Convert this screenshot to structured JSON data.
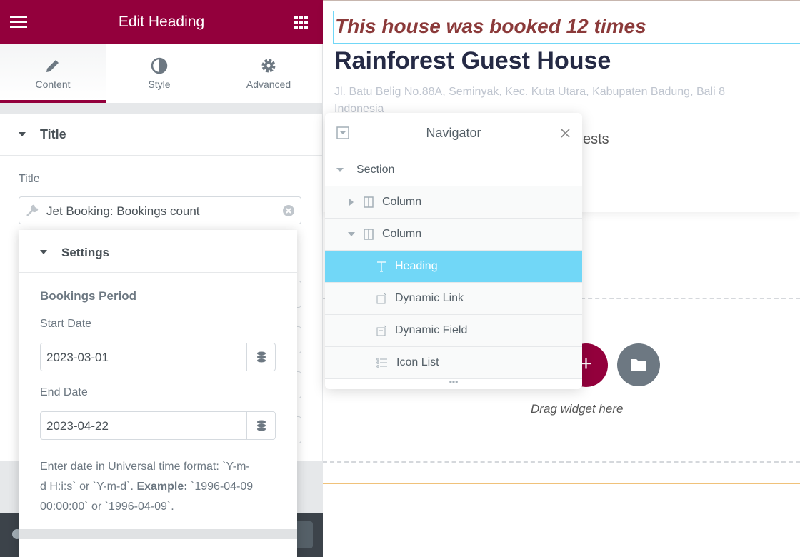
{
  "panel": {
    "title": "Edit Heading",
    "tabs": [
      {
        "label": "Content",
        "icon": "pencil-icon"
      },
      {
        "label": "Style",
        "icon": "contrast-icon"
      },
      {
        "label": "Advanced",
        "icon": "gear-icon"
      }
    ],
    "section": "Title",
    "field_label": "Title",
    "field_value": "Jet Booking: Bookings count"
  },
  "popover": {
    "title": "Settings",
    "group": "Bookings Period",
    "start_label": "Start Date",
    "start_value": "2023-03-01",
    "end_label": "End Date",
    "end_value": "2023-04-22",
    "help_1": "Enter date in Universal time format: `Y-m-d H:i:s` or `Y-m-d`.",
    "help_bold": "Example:",
    "help_2": "`1996-04-09 00:00:00` or `1996-04-09`."
  },
  "canvas": {
    "booked": "This house was booked 12 times",
    "name": "Rainforest Guest House",
    "address": "Jl. Batu Belig No.88A, Seminyak, Kec. Kuta Utara, Kabupaten Badung, Bali 8",
    "address2": "Indonesia",
    "guests": "ests",
    "drag": "Drag widget here"
  },
  "navigator": {
    "title": "Navigator",
    "items": [
      {
        "label": "Section",
        "icon": "caret-down-icon"
      },
      {
        "label": "Column",
        "icon": "column-icon"
      },
      {
        "label": "Column",
        "icon": "column-icon"
      },
      {
        "label": "Heading",
        "icon": "heading-icon"
      },
      {
        "label": "Dynamic Link",
        "icon": "dynamic-link-icon"
      },
      {
        "label": "Dynamic Field",
        "icon": "dynamic-field-icon"
      },
      {
        "label": "Icon List",
        "icon": "icon-list-icon"
      }
    ]
  },
  "colors": {
    "brand": "#93003c",
    "selected": "#71d7f7",
    "booked_text": "#8b3a3a"
  }
}
